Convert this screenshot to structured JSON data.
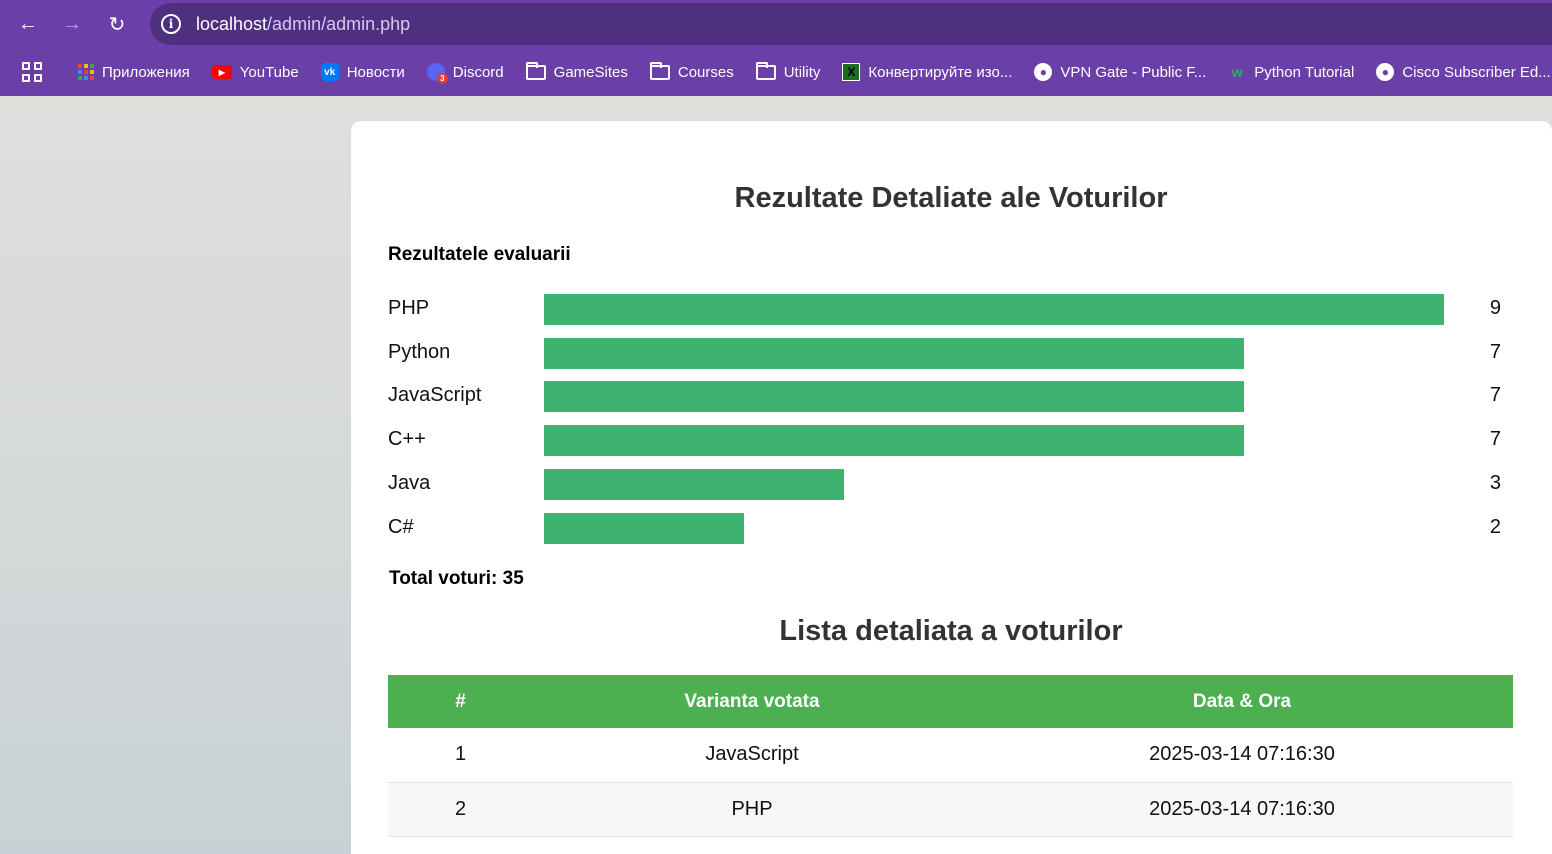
{
  "browser": {
    "url_host": "localhost",
    "url_path": "/admin/admin.php",
    "bookmarks": [
      {
        "label": "Приложения",
        "icon": "apps-grid-icon"
      },
      {
        "label": "YouTube",
        "icon": "youtube-icon"
      },
      {
        "label": "Новости",
        "icon": "vk-icon"
      },
      {
        "label": "Discord",
        "icon": "discord-icon",
        "badge": "3"
      },
      {
        "label": "GameSites",
        "icon": "folder-icon"
      },
      {
        "label": "Courses",
        "icon": "folder-icon"
      },
      {
        "label": "Utility",
        "icon": "folder-icon"
      },
      {
        "label": "Конвертируйте изо...",
        "icon": "converter-icon"
      },
      {
        "label": "VPN Gate - Public F...",
        "icon": "globe-icon"
      },
      {
        "label": "Python Tutorial",
        "icon": "w3-icon"
      },
      {
        "label": "Cisco Subscriber Ed...",
        "icon": "globe-icon"
      }
    ]
  },
  "page": {
    "title": "Rezultate Detaliate ale Voturilor",
    "subtitle": "Rezultatele evaluarii",
    "total_label": "Total voturi: 35",
    "list_title": "Lista detaliata a voturilor",
    "bar_color": "#3eb370",
    "header_color": "#4caf50"
  },
  "chart_data": {
    "type": "bar",
    "orientation": "horizontal",
    "title": "Rezultatele evaluarii",
    "categories": [
      "PHP",
      "Python",
      "JavaScript",
      "C++",
      "Java",
      "C#"
    ],
    "values": [
      9,
      7,
      7,
      7,
      3,
      2
    ],
    "xlim": [
      0,
      9
    ]
  },
  "table": {
    "headers": [
      "#",
      "Varianta votata",
      "Data & Ora"
    ],
    "rows": [
      [
        "1",
        "JavaScript",
        "2025-03-14 07:16:30"
      ],
      [
        "2",
        "PHP",
        "2025-03-14 07:16:30"
      ]
    ]
  }
}
